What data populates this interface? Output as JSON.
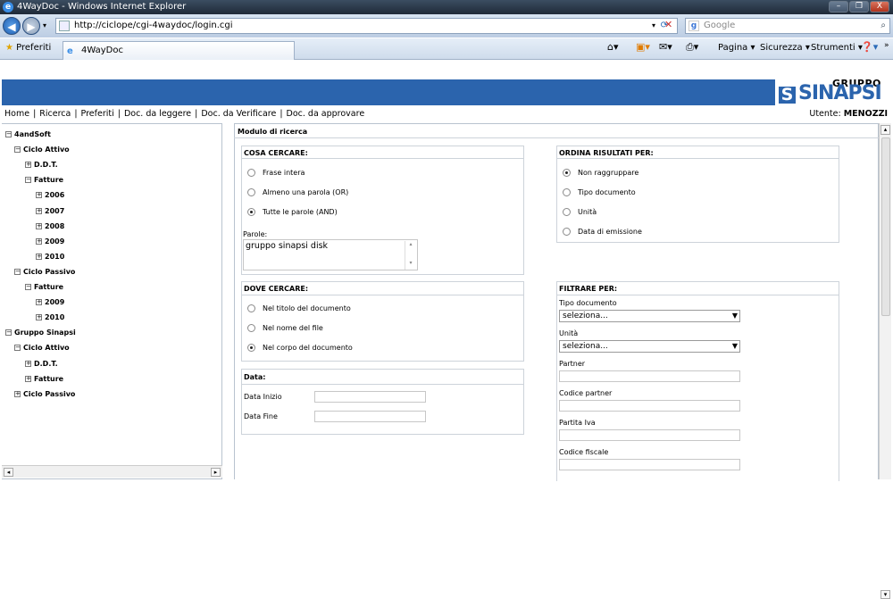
{
  "window": {
    "title": "4WayDoc - Windows Internet Explorer",
    "minimize": "–",
    "restore": "❐",
    "close": "X"
  },
  "browser": {
    "url": "http://ciclope/cgi-4waydoc/login.cgi",
    "search_placeholder": "Google",
    "favorites_label": "Preferiti",
    "tab_title": "4WayDoc",
    "commands": {
      "pagina": "Pagina",
      "sicurezza": "Sicurezza",
      "strumenti": "Strumenti"
    }
  },
  "logo": {
    "gruppo": "GRUPPO",
    "brand": "SINAPSI",
    "letter": "S"
  },
  "nav_menu": [
    "Home",
    "Ricerca",
    "Preferiti",
    "Doc. da leggere",
    "Doc. da Verificare",
    "Doc. da approvare"
  ],
  "nav_separator": "|",
  "user": {
    "label": "Utente:",
    "name": "MENOZZI"
  },
  "tree": [
    {
      "label": "4andSoft",
      "sign": "−",
      "level": 0
    },
    {
      "label": "Ciclo Attivo",
      "sign": "−",
      "level": 1
    },
    {
      "label": "D.D.T.",
      "sign": "+",
      "level": 2
    },
    {
      "label": "Fatture",
      "sign": "−",
      "level": 2
    },
    {
      "label": "2006",
      "sign": "+",
      "level": 3
    },
    {
      "label": "2007",
      "sign": "+",
      "level": 3
    },
    {
      "label": "2008",
      "sign": "+",
      "level": 3
    },
    {
      "label": "2009",
      "sign": "+",
      "level": 3
    },
    {
      "label": "2010",
      "sign": "+",
      "level": 3
    },
    {
      "label": "Ciclo Passivo",
      "sign": "−",
      "level": 1
    },
    {
      "label": "Fatture",
      "sign": "−",
      "level": 2
    },
    {
      "label": "2009",
      "sign": "+",
      "level": 3
    },
    {
      "label": "2010",
      "sign": "+",
      "level": 3
    },
    {
      "label": "Gruppo Sinapsi",
      "sign": "−",
      "level": 0
    },
    {
      "label": "Ciclo Attivo",
      "sign": "−",
      "level": 1
    },
    {
      "label": "D.D.T.",
      "sign": "+",
      "level": 2
    },
    {
      "label": "Fatture",
      "sign": "+",
      "level": 2
    },
    {
      "label": "Ciclo Passivo",
      "sign": "+",
      "level": 1
    }
  ],
  "form": {
    "title": "Modulo di ricerca",
    "cosa": {
      "header": "COSA CERCARE:",
      "options": [
        "Frase intera",
        "Almeno una parola (OR)",
        "Tutte le parole (AND)"
      ],
      "selected": "Tutte le parole (AND)",
      "words_label": "Parole:",
      "words_value": "gruppo sinapsi disk"
    },
    "ordina": {
      "header": "ORDINA RISULTATI PER:",
      "options": [
        "Non raggruppare",
        "Tipo documento",
        "Unità",
        "Data di emissione"
      ],
      "selected": "Non raggruppare"
    },
    "dove": {
      "header": "DOVE CERCARE:",
      "options": [
        "Nel titolo del documento",
        "Nel nome del file",
        "Nel corpo del documento"
      ],
      "selected": "Nel corpo del documento"
    },
    "data": {
      "header": "Data:",
      "start_label": "Data Inizio",
      "end_label": "Data Fine",
      "start_value": "",
      "end_value": ""
    },
    "filtrare": {
      "header": "FILTRARE PER:",
      "tipo_label": "Tipo documento",
      "tipo_value": "seleziona...",
      "unita_label": "Unità",
      "unita_value": "seleziona...",
      "partner_label": "Partner",
      "codice_partner_label": "Codice partner",
      "partita_iva_label": "Partita Iva",
      "codice_fiscale_label": "Codice fiscale"
    }
  }
}
